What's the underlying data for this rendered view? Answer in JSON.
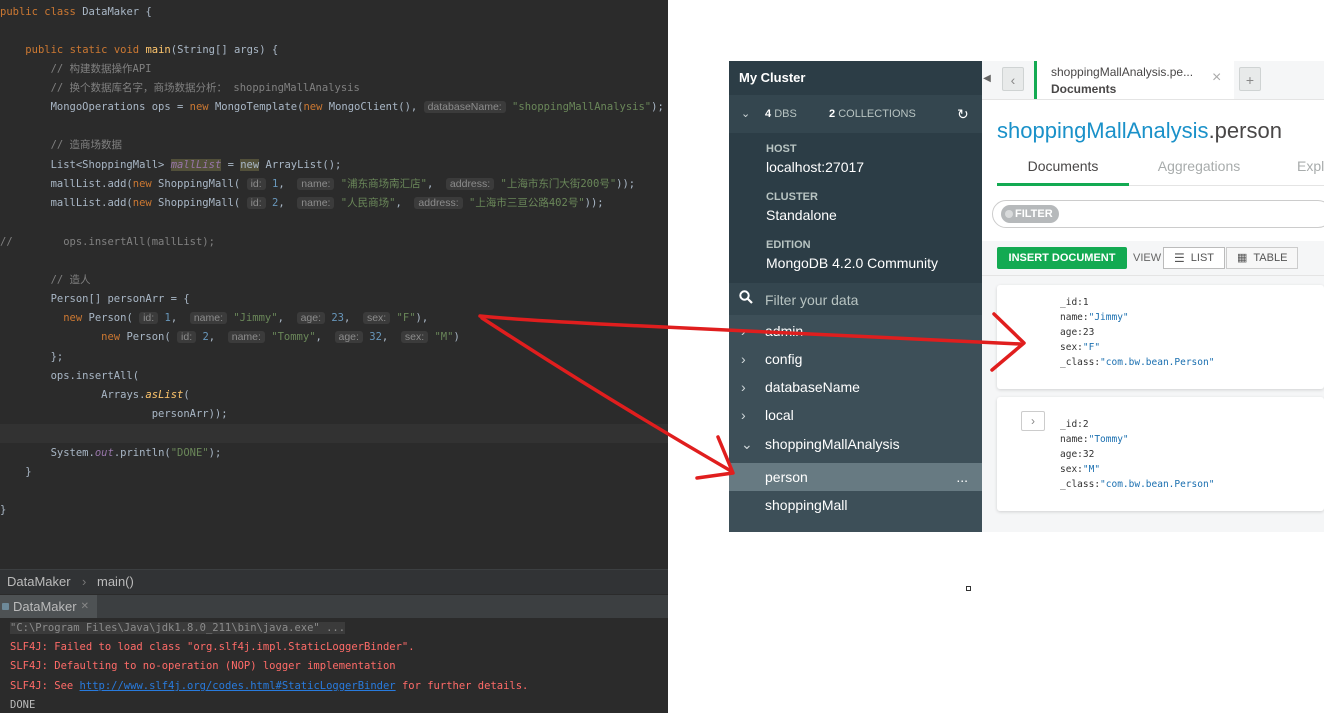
{
  "editor": {
    "class_line": [
      "public",
      "class",
      "DataMaker",
      "{"
    ],
    "main_sig": [
      "public",
      "static",
      "void",
      "main",
      "(String[] args) {"
    ],
    "comment_api": "// 构建数据操作API",
    "comment_db": "// 换个数据库名字，商场数据分析：",
    "comment_db_name": "shoppingMallAnalysis",
    "ops_line": {
      "a": "MongoOperations ops = ",
      "new1": "new",
      "b": " MongoTemplate(",
      "new2": "new",
      "c": " MongoClient(), ",
      "hint": "databaseName:",
      "str": "\"shoppingMallAnalysis\"",
      "end": ");"
    },
    "comment_mall": "// 造商场数据",
    "list_line": {
      "a": "List<ShoppingMall> ",
      "var": "mallList",
      "b": " = ",
      "new": "new",
      "c": " ArrayList();"
    },
    "add1": {
      "a": "mallList.add(",
      "new": "new",
      "b": " ShoppingMall( ",
      "h_id": "id:",
      "id": "1",
      "h_name": "name:",
      "name": "\"浦东商场南汇店\"",
      "h_addr": "address:",
      "addr": "\"上海市东门大街200号\"",
      "end": "));"
    },
    "add2": {
      "a": "mallList.add(",
      "new": "new",
      "b": " ShoppingMall( ",
      "h_id": "id:",
      "id": "2",
      "h_name": "name:",
      "name": "\"人民商场\"",
      "h_addr": "address:",
      "addr": "\"上海市三亘公路402号\"",
      "end": "));"
    },
    "commented_insert": "//        ops.insertAll(mallList);",
    "comment_person": "// 造人",
    "person_arr": "Person[] personArr = {",
    "p1": {
      "new": "new",
      "a": " Person( ",
      "h_id": "id:",
      "id": "1",
      "h_name": "name:",
      "name": "\"Jimmy\"",
      "h_age": "age:",
      "age": "23",
      "h_sex": "sex:",
      "sex": "\"F\"",
      "end": "),"
    },
    "p2": {
      "new": "new",
      "a": " Person( ",
      "h_id": "id:",
      "id": "2",
      "h_name": "name:",
      "name": "\"Tommy\"",
      "h_age": "age:",
      "age": "32",
      "h_sex": "sex:",
      "sex": "\"M\"",
      "end": ")"
    },
    "close_arr": "};",
    "insert_all": "ops.insertAll(",
    "arrays_a": "Arrays.",
    "arrays_b": "asList",
    "arrays_c": "(",
    "person_arr_end": "personArr));",
    "println_a": "System.",
    "println_out": "out",
    "println_b": ".println(",
    "println_str": "\"DONE\"",
    "println_end": ");",
    "close1": "}",
    "close2": "}"
  },
  "breadcrumb": {
    "class": "DataMaker",
    "sep": "›",
    "method": "main()"
  },
  "run_tab": {
    "label": "DataMaker",
    "close": "✕"
  },
  "console": {
    "exe_line": "\"C:\\Program Files\\Java\\jdk1.8.0_211\\bin\\java.exe\" ...",
    "err1": "SLF4J: Failed to load class \"org.slf4j.impl.StaticLoggerBinder\".",
    "err2": "SLF4J: Defaulting to no-operation (NOP) logger implementation",
    "err3_a": "SLF4J: See ",
    "err3_link": "http://www.slf4j.org/codes.html#StaticLoggerBinder",
    "err3_b": " for further details.",
    "done": "DONE"
  },
  "compass": {
    "cluster_title": "My Cluster",
    "dbs_count": "4",
    "dbs_label": "DBS",
    "coll_count": "2",
    "coll_label": "COLLECTIONS",
    "host_label": "HOST",
    "host_value": "localhost:27017",
    "cluster_label": "CLUSTER",
    "cluster_value": "Standalone",
    "edition_label": "EDITION",
    "edition_value": "MongoDB 4.2.0 Community",
    "filter_placeholder": "Filter your data",
    "databases": [
      {
        "name": "admin",
        "expanded": false
      },
      {
        "name": "config",
        "expanded": false
      },
      {
        "name": "databaseName",
        "expanded": false
      },
      {
        "name": "local",
        "expanded": false
      },
      {
        "name": "shoppingMallAnalysis",
        "expanded": true
      }
    ],
    "collections": [
      {
        "name": "person",
        "selected": true,
        "menu": "..."
      },
      {
        "name": "shoppingMall",
        "selected": false
      }
    ],
    "tab_title": "shoppingMallAnalysis.pe...",
    "tab_subtitle": "Documents",
    "tab_close": "×",
    "tab_add": "+",
    "ns_db": "shoppingMallAnalysis",
    "ns_coll": ".person",
    "subtabs": [
      "Documents",
      "Aggregations",
      "Expl"
    ],
    "filter_label": "FILTER",
    "insert_button": "INSERT DOCUMENT",
    "view_label": "VIEW",
    "list_label": "LIST",
    "table_label": "TABLE",
    "documents": [
      {
        "_id": "1",
        "name": "\"Jimmy\"",
        "age": "23",
        "sex": "\"F\"",
        "_class": "\"com.bw.bean.Person\""
      },
      {
        "_id": "2",
        "name": "\"Tommy\"",
        "age": "32",
        "sex": "\"M\"",
        "_class": "\"com.bw.bean.Person\""
      }
    ],
    "field_keys": {
      "id": "_id:",
      "name": "name:",
      "age": "age:",
      "sex": "sex:",
      "cls": "_class:"
    }
  },
  "colors": {
    "accent_green": "#13aa52",
    "sidebar": "#3d4f58",
    "arrow_red": "#e01e1e"
  }
}
